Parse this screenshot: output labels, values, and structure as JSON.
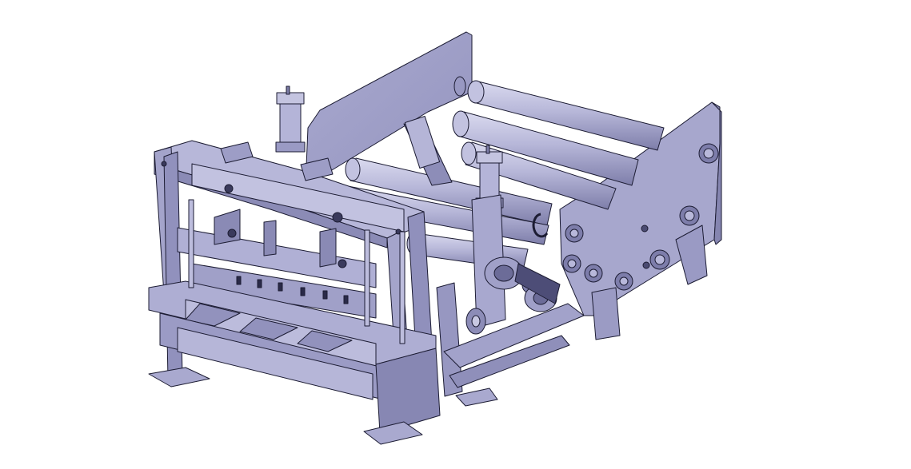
{
  "scene": {
    "subject": "cad-assembly-render",
    "components": [
      {
        "name": "side-frame-plate",
        "count": 2
      },
      {
        "name": "roller",
        "count": 6
      },
      {
        "name": "pneumatic-cylinder",
        "count": 2
      },
      {
        "name": "shear-frame",
        "count": 1
      },
      {
        "name": "bearing-flange",
        "count": 9
      },
      {
        "name": "handwheel",
        "count": 1
      },
      {
        "name": "pulley",
        "count": 2
      }
    ]
  },
  "colors": {
    "background": "#ffffff",
    "face_light": "#c8c8e2",
    "face_mid": "#a3a3c9",
    "face_dark": "#7b7ba6",
    "edge": "#1c1c33",
    "shadow": "#5f5f8a"
  }
}
